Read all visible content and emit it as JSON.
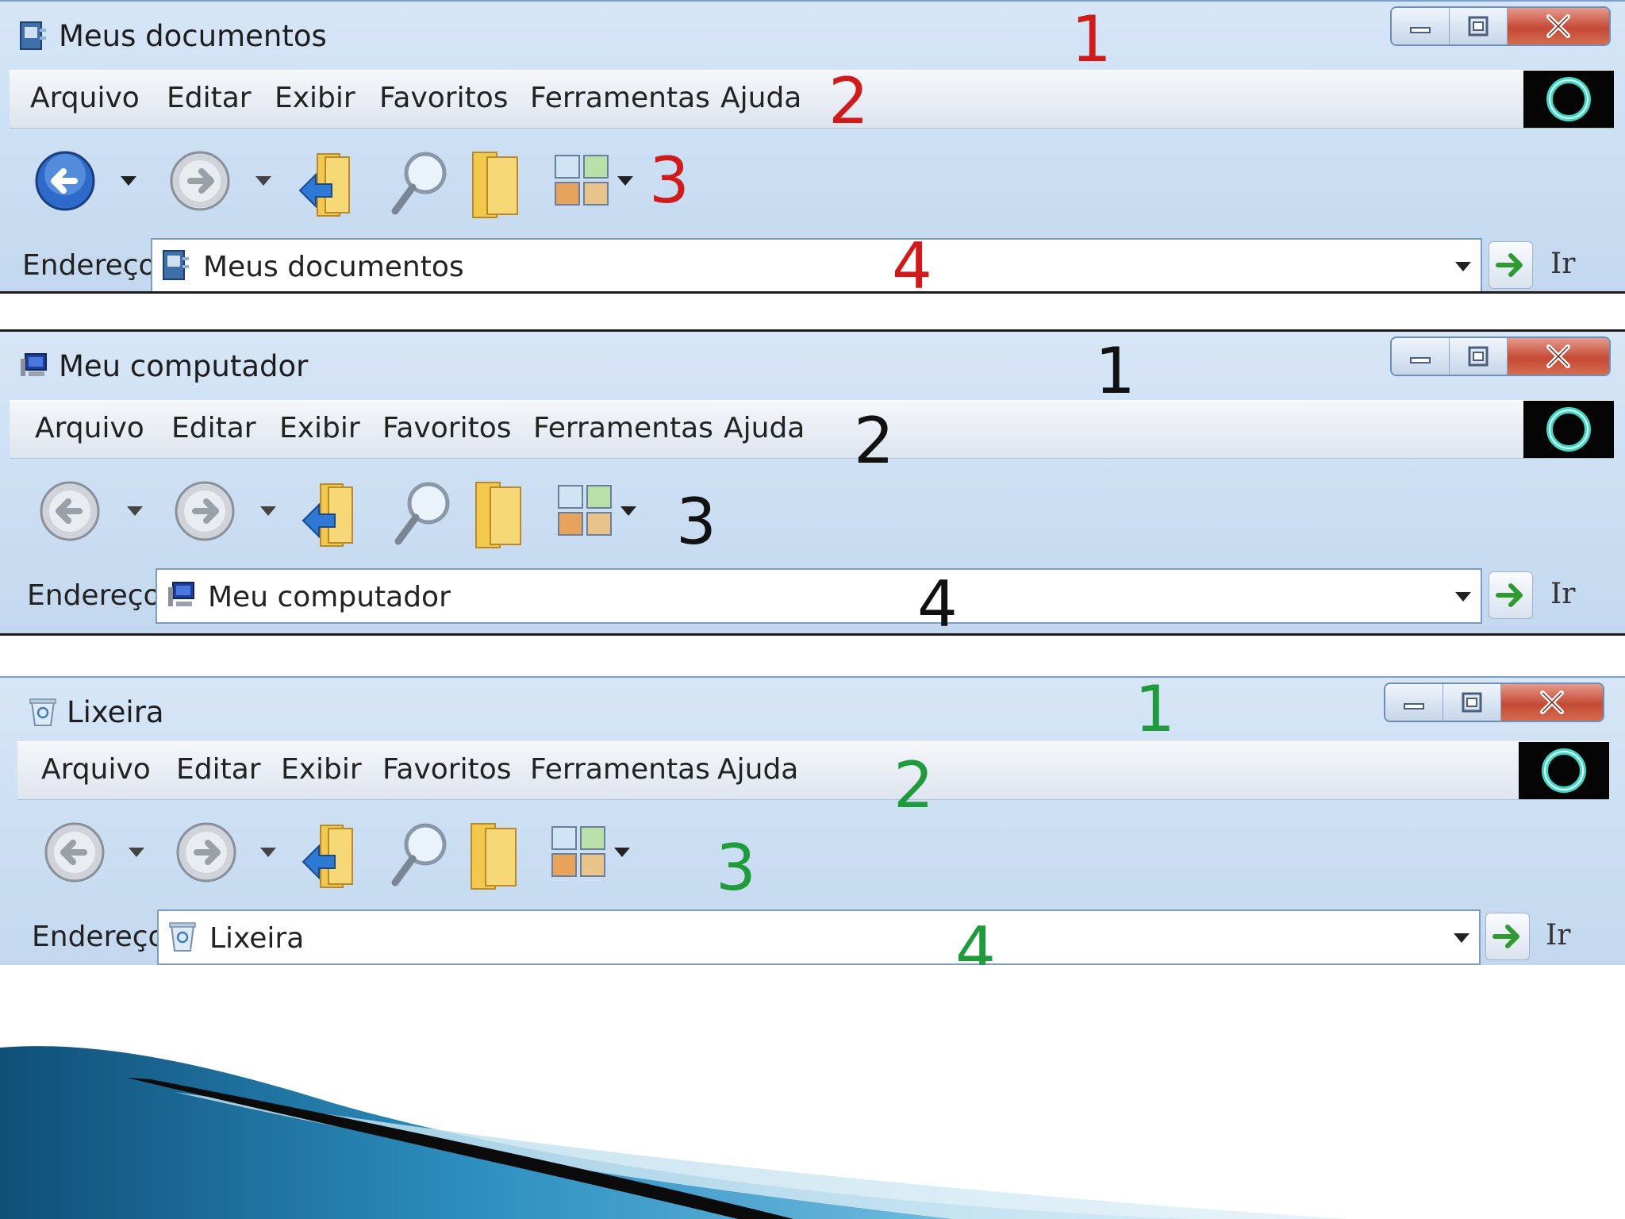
{
  "menu_labels": {
    "file": "Arquivo",
    "edit": "Editar",
    "view": "Exibir",
    "favorites": "Favoritos",
    "tools": "Ferramentas",
    "help": "Ajuda"
  },
  "address_label": "Endereço",
  "go_label": "Ir",
  "windows": [
    {
      "title": "Meus documentos",
      "title_icon": "my-documents-icon",
      "address_value": "Meus documentos",
      "back_enabled": true,
      "annotation_color": "#d11a1a",
      "annotations": [
        "1",
        "2",
        "3",
        "4"
      ]
    },
    {
      "title": "Meu computador",
      "title_icon": "my-computer-icon",
      "address_value": "Meu computador",
      "back_enabled": false,
      "annotation_color": "#111111",
      "annotations": [
        "1",
        "2",
        "3",
        "4"
      ]
    },
    {
      "title": "Lixeira",
      "title_icon": "recycle-bin-icon",
      "address_value": "Lixeira",
      "back_enabled": false,
      "annotation_color": "#1f9a3c",
      "annotations": [
        "1",
        "2",
        "3",
        "4"
      ]
    }
  ],
  "toolbar_icons": [
    "back-arrow-icon",
    "forward-arrow-icon",
    "up-folder-icon",
    "search-magnifier-icon",
    "folders-icon",
    "views-icon"
  ],
  "accent_colors": {
    "window_bg": "#c9dcf1",
    "close_button": "#c44a35"
  }
}
